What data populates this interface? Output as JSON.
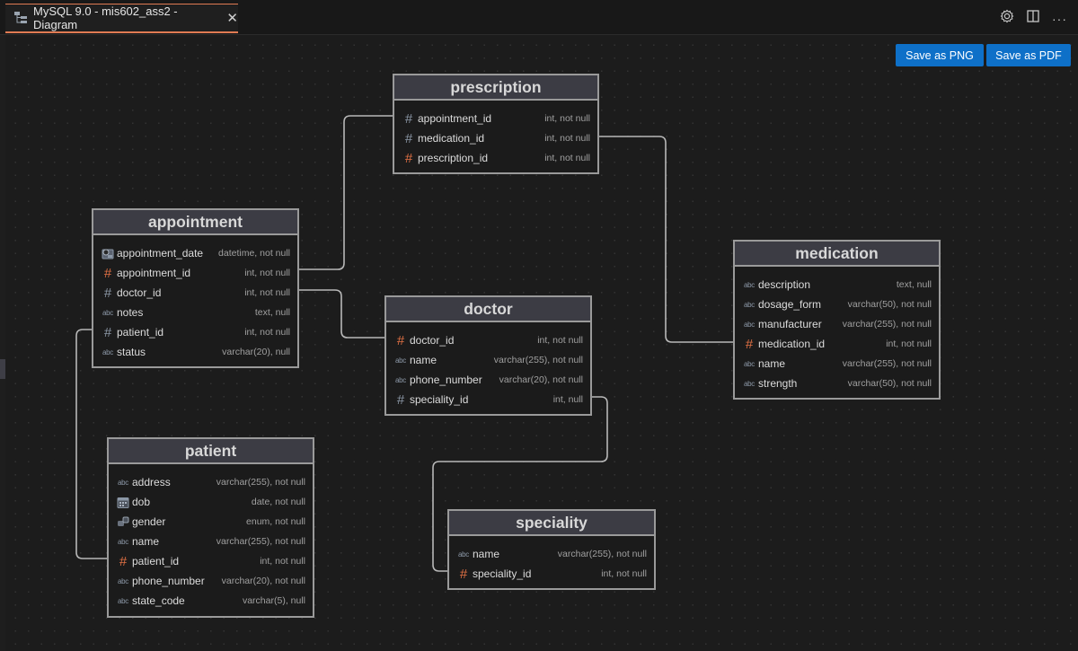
{
  "tab": {
    "title": "MySQL 9.0 - mis602_ass2 - Diagram",
    "icon": "diagram-icon",
    "close_icon": "close-icon"
  },
  "top_actions": {
    "settings_icon": "gear-icon",
    "split_icon": "split-editor-icon",
    "more_icon": "more-icon",
    "more_label": "···"
  },
  "toolbar": {
    "save_png_label": "Save as PNG",
    "save_pdf_label": "Save as PDF"
  },
  "colors": {
    "accent": "#e07b53",
    "button": "#0e70c8",
    "pk": "#e07044",
    "line": "#b8b8b8"
  },
  "entities": {
    "prescription": {
      "name": "prescription",
      "columns": [
        {
          "name": "appointment_id",
          "type": "int, not null",
          "icon": "hash",
          "pk": false
        },
        {
          "name": "medication_id",
          "type": "int, not null",
          "icon": "hash",
          "pk": false
        },
        {
          "name": "prescription_id",
          "type": "int, not null",
          "icon": "hash",
          "pk": true
        }
      ]
    },
    "appointment": {
      "name": "appointment",
      "columns": [
        {
          "name": "appointment_date",
          "type": "datetime, not null",
          "icon": "datetime",
          "pk": false
        },
        {
          "name": "appointment_id",
          "type": "int, not null",
          "icon": "hash",
          "pk": true
        },
        {
          "name": "doctor_id",
          "type": "int, not null",
          "icon": "hash",
          "pk": false
        },
        {
          "name": "notes",
          "type": "text, null",
          "icon": "abc",
          "pk": false
        },
        {
          "name": "patient_id",
          "type": "int, not null",
          "icon": "hash",
          "pk": false
        },
        {
          "name": "status",
          "type": "varchar(20), null",
          "icon": "abc",
          "pk": false
        }
      ]
    },
    "doctor": {
      "name": "doctor",
      "columns": [
        {
          "name": "doctor_id",
          "type": "int, not null",
          "icon": "hash",
          "pk": true
        },
        {
          "name": "name",
          "type": "varchar(255), not null",
          "icon": "abc",
          "pk": false
        },
        {
          "name": "phone_number",
          "type": "varchar(20), not null",
          "icon": "abc",
          "pk": false
        },
        {
          "name": "speciality_id",
          "type": "int, null",
          "icon": "hash",
          "pk": false
        }
      ]
    },
    "medication": {
      "name": "medication",
      "columns": [
        {
          "name": "description",
          "type": "text, null",
          "icon": "abc",
          "pk": false
        },
        {
          "name": "dosage_form",
          "type": "varchar(50), not null",
          "icon": "abc",
          "pk": false
        },
        {
          "name": "manufacturer",
          "type": "varchar(255), not null",
          "icon": "abc",
          "pk": false
        },
        {
          "name": "medication_id",
          "type": "int, not null",
          "icon": "hash",
          "pk": true
        },
        {
          "name": "name",
          "type": "varchar(255), not null",
          "icon": "abc",
          "pk": false
        },
        {
          "name": "strength",
          "type": "varchar(50), not null",
          "icon": "abc",
          "pk": false
        }
      ]
    },
    "patient": {
      "name": "patient",
      "columns": [
        {
          "name": "address",
          "type": "varchar(255), not null",
          "icon": "abc",
          "pk": false
        },
        {
          "name": "dob",
          "type": "date, not null",
          "icon": "date",
          "pk": false
        },
        {
          "name": "gender",
          "type": "enum, not null",
          "icon": "enum",
          "pk": false
        },
        {
          "name": "name",
          "type": "varchar(255), not null",
          "icon": "abc",
          "pk": false
        },
        {
          "name": "patient_id",
          "type": "int, not null",
          "icon": "hash",
          "pk": true
        },
        {
          "name": "phone_number",
          "type": "varchar(20), not null",
          "icon": "abc",
          "pk": false
        },
        {
          "name": "state_code",
          "type": "varchar(5), null",
          "icon": "abc",
          "pk": false
        }
      ]
    },
    "speciality": {
      "name": "speciality",
      "columns": [
        {
          "name": "name",
          "type": "varchar(255), not null",
          "icon": "abc",
          "pk": false
        },
        {
          "name": "speciality_id",
          "type": "int, not null",
          "icon": "hash",
          "pk": true
        }
      ]
    }
  },
  "relationships": [
    {
      "from": "appointment.appointment_id",
      "to": "prescription.appointment_id"
    },
    {
      "from": "appointment.doctor_id",
      "to": "doctor.doctor_id"
    },
    {
      "from": "appointment.patient_id",
      "to": "patient.patient_id"
    },
    {
      "from": "prescription.medication_id",
      "to": "medication.medication_id"
    },
    {
      "from": "doctor.speciality_id",
      "to": "speciality.speciality_id"
    }
  ]
}
